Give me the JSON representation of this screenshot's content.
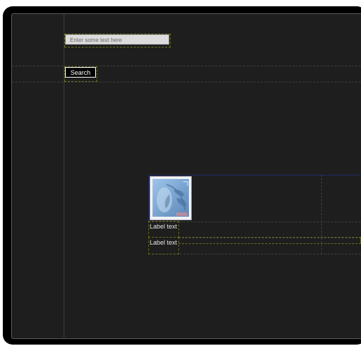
{
  "form": {
    "text_placeholder": "Enter some text here",
    "search_label": "Search"
  },
  "list": {
    "image_icon": "image-thumbnail-icon",
    "labels": [
      "Label text",
      "Label text"
    ]
  },
  "colors": {
    "background": "#1e1e1e",
    "frame": "#000000",
    "guide_line": "#3f3f3f",
    "outline_guide": "#6e6e1e",
    "selection": "#1f2a66"
  }
}
